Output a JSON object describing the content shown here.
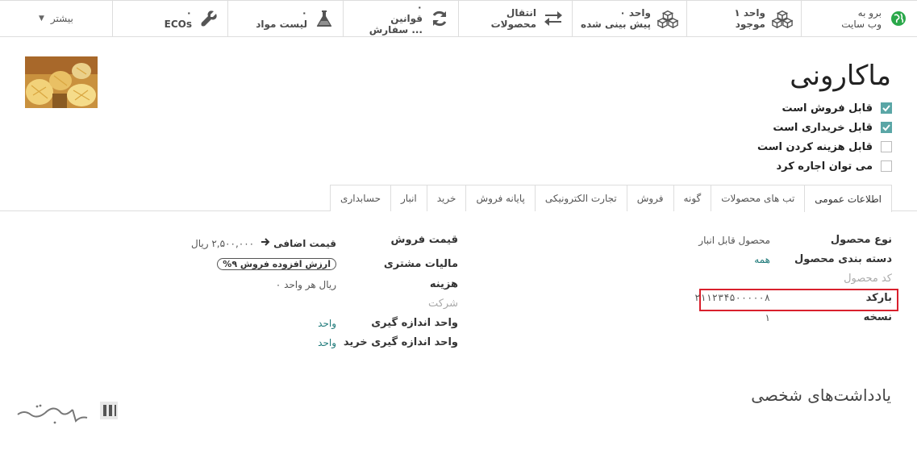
{
  "smart_buttons": [
    {
      "name": "website",
      "line1": "برو به",
      "line2": "وب سایت",
      "icon": "globe-icon"
    },
    {
      "name": "on-hand",
      "line1": "۱ واحد",
      "line2": "موجود",
      "icon": "cubes-icon"
    },
    {
      "name": "forecasted",
      "line1": "۰ واحد",
      "line2": "پیش بینی شده",
      "icon": "cubes-icon"
    },
    {
      "name": "product-moves",
      "line1": "انتقال محصولات",
      "line2": "",
      "icon": "exchange-icon"
    },
    {
      "name": "reordering",
      "line1": "۰",
      "line2": "قوانین سفارش ...",
      "icon": "refresh-icon"
    },
    {
      "name": "bom",
      "line1": "۰",
      "line2": "لیست مواد",
      "icon": "flask-icon"
    },
    {
      "name": "ecos",
      "line1": "۰",
      "line2": "ECOs",
      "icon": "wrench-icon"
    }
  ],
  "more_label": "بیشتر",
  "product": {
    "name": "ماکارونی",
    "checks": [
      {
        "label": "قابل فروش است",
        "checked": true
      },
      {
        "label": "قابل خریداری است",
        "checked": true
      },
      {
        "label": "قابل هزینه کردن است",
        "checked": false
      },
      {
        "label": "می توان اجاره کرد",
        "checked": false
      }
    ]
  },
  "tabs": [
    "اطلاعات عمومی",
    "تب های محصولات",
    "گونه",
    "فروش",
    "تجارت الکترونیکی",
    "پایانه فروش",
    "خرید",
    "انبار",
    "حسابداری"
  ],
  "right_fields": {
    "product_type_label": "نوع محصول",
    "product_type_value": "محصول قابل انبار",
    "category_label": "دسته بندی محصول",
    "category_value": "همه",
    "ref_label": "کد محصول",
    "barcode_label": "بارکد",
    "barcode_value": "۲۱۱۲۳۴۵۰۰۰۰۰۸",
    "version_label": "نسخه",
    "version_value": "۱"
  },
  "left_fields": {
    "sales_price_label": "قیمت فروش",
    "sales_price_value": "۲,۵۰۰,۰۰۰ ریال",
    "extra_price_label": "قیمت اضافی",
    "customer_tax_label": "مالیات مشتری",
    "customer_tax_value": "ارزش افزوده فروش ۹%",
    "cost_label": "هزینه",
    "cost_value": "۰ ریال هر واحد",
    "company_label": "شرکت",
    "uom_label": "واحد اندازه گیری",
    "uom_value": "واحد",
    "purchase_uom_label": "واحد اندازه گیری خرید",
    "purchase_uom_value": "واحد"
  },
  "notes_title": "یادداشت‌های شخصی",
  "colors": {
    "accent": "#5aa6a6",
    "link": "#1f7a7a",
    "highlight": "#d9202d",
    "globe": "#2aa84a"
  }
}
